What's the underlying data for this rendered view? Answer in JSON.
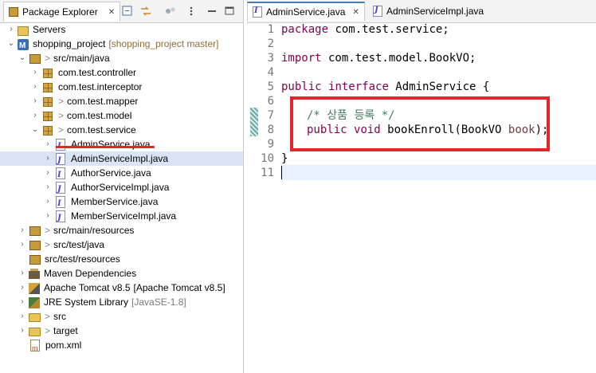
{
  "package_explorer": {
    "tab_title": "Package Explorer",
    "tree": [
      {
        "label": "Servers",
        "icon": "servers-folder-icon"
      },
      {
        "label": "shopping_project",
        "extra": "[shopping_project master]",
        "icon": "maven-project-icon"
      },
      {
        "label": "src/main/java",
        "icon": "source-folder-icon"
      },
      {
        "label": "com.test.controller",
        "icon": "package-icon"
      },
      {
        "label": "com.test.interceptor",
        "icon": "package-icon"
      },
      {
        "label": "com.test.mapper",
        "icon": "package-icon"
      },
      {
        "label": "com.test.model",
        "icon": "package-icon"
      },
      {
        "label": "com.test.service",
        "icon": "package-icon"
      },
      {
        "label": "AdminService.java",
        "icon": "java-interface-file-icon"
      },
      {
        "label": "AdminServiceImpl.java",
        "icon": "java-file-icon"
      },
      {
        "label": "AuthorService.java",
        "icon": "java-interface-file-icon"
      },
      {
        "label": "AuthorServiceImpl.java",
        "icon": "java-file-icon"
      },
      {
        "label": "MemberService.java",
        "icon": "java-interface-file-icon"
      },
      {
        "label": "MemberServiceImpl.java",
        "icon": "java-file-icon"
      },
      {
        "label": "src/main/resources",
        "icon": "source-folder-icon"
      },
      {
        "label": "src/test/java",
        "icon": "source-folder-icon"
      },
      {
        "label": "src/test/resources",
        "icon": "source-folder-icon"
      },
      {
        "label": "Maven Dependencies",
        "icon": "library-icon"
      },
      {
        "label": "Apache Tomcat v8.5",
        "extra": "[Apache Tomcat v8.5]",
        "icon": "tomcat-library-icon"
      },
      {
        "label": "JRE System Library",
        "extra": "[JavaSE-1.8]",
        "icon": "jre-library-icon"
      },
      {
        "label": "src",
        "icon": "folder-icon"
      },
      {
        "label": "target",
        "icon": "folder-icon"
      },
      {
        "label": "pom.xml",
        "icon": "xml-file-icon"
      }
    ],
    "gt": ">"
  },
  "editor": {
    "tabs": [
      {
        "label": "AdminService.java",
        "active": true
      },
      {
        "label": "AdminServiceImpl.java",
        "active": false
      }
    ],
    "close_glyph": "✕",
    "line_numbers": [
      "1",
      "2",
      "3",
      "4",
      "5",
      "6",
      "7",
      "8",
      "9",
      "10",
      "11"
    ],
    "code": {
      "l1_kw": "package",
      "l1_rest": " com.test.service;",
      "l3_kw": "import",
      "l3_rest": " com.test.model.BookVO;",
      "l5_kw1": "public",
      "l5_kw2": "interface",
      "l5_rest": " AdminService {",
      "l7_comment": "/* 상품 등록 */",
      "l8_kw1": "public",
      "l8_kw2": "void",
      "l8_rest1": " bookEnroll(BookVO ",
      "l8_param": "book",
      "l8_rest2": ");",
      "l10": "}"
    }
  },
  "colors": {
    "keyword": "#7f0055",
    "comment": "#3f7f5f",
    "annotation_red": "#e3262c",
    "selection": "#dbe4f5"
  }
}
